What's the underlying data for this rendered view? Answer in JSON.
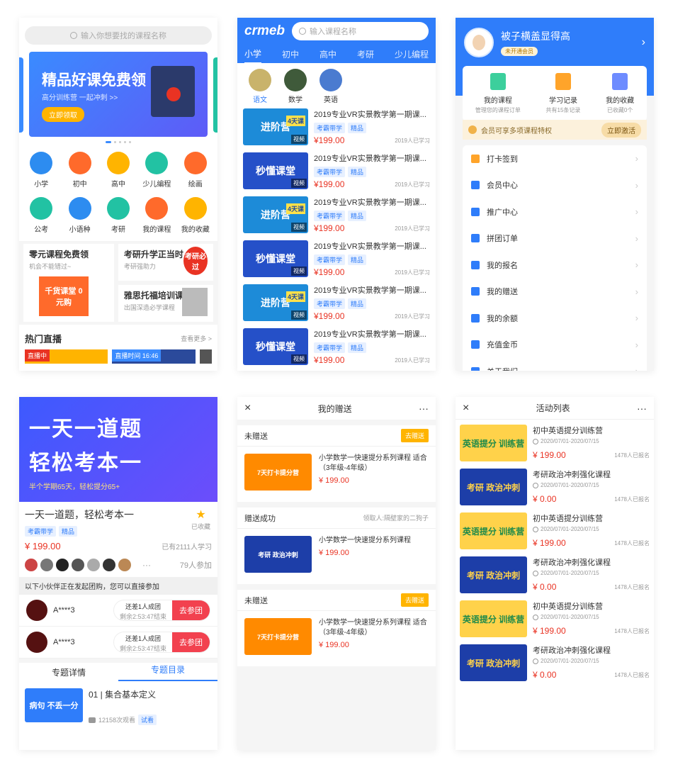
{
  "home": {
    "search_placeholder": "输入你想要找的课程名称",
    "banner_title": "精品好课免费领",
    "banner_sub": "高分训练营 一起冲刺 >>",
    "banner_btn": "立即领取",
    "cats": [
      {
        "label": "小学",
        "color": "#2d8cf0",
        "icon": "leaf-icon"
      },
      {
        "label": "初中",
        "color": "#ff6a2b",
        "icon": "book-icon"
      },
      {
        "label": "高中",
        "color": "#ffb400",
        "icon": "pencil-icon"
      },
      {
        "label": "少儿编程",
        "color": "#22c2a3",
        "icon": "code-icon"
      },
      {
        "label": "绘画",
        "color": "#ff6a2b",
        "icon": "palette-icon"
      },
      {
        "label": "公考",
        "color": "#22c2a3",
        "icon": "people-icon"
      },
      {
        "label": "小语种",
        "color": "#2d8cf0",
        "icon": "globe-icon"
      },
      {
        "label": "考研",
        "color": "#22c2a3",
        "icon": "cap-icon"
      },
      {
        "label": "我的课程",
        "color": "#ff6a2b",
        "icon": "open-book-icon"
      },
      {
        "label": "我的收藏",
        "color": "#ffb400",
        "icon": "star-icon"
      }
    ],
    "promo1_title": "零元课程免费领",
    "promo1_sub": "机会不能错过~",
    "promo1_img": "千货课堂 0元购",
    "promo2_title": "考研升学正当时",
    "promo2_sub": "考研强助力",
    "promo2_img": "考研必过",
    "promo3_title": "雅思托福培训课",
    "promo3_sub": "出国深造必学课程",
    "live_title": "热门直播",
    "live_more": "查看更多 >",
    "live_badge1": "直播中",
    "live_badge2": "直播时间 16:46"
  },
  "list": {
    "logo": "crmeb",
    "search_placeholder": "输入课程名称",
    "tabs": [
      "小学",
      "初中",
      "高中",
      "考研",
      "少儿编程"
    ],
    "subjects": [
      "语文",
      "数学",
      "英语"
    ],
    "items": [
      {
        "title": "2019专业VR实景教学第一期课...",
        "img": "进阶营",
        "badge": "4天课",
        "tags": [
          "考霸带学",
          "精品"
        ],
        "price": "¥199.00",
        "count": "2019人已学习",
        "type": "视频"
      },
      {
        "title": "2019专业VR实景教学第一期课...",
        "img": "秒懂课堂",
        "badge": "",
        "tags": [
          "考霸带学",
          "精品"
        ],
        "price": "¥199.00",
        "count": "2019人已学习",
        "type": "视频"
      },
      {
        "title": "2019专业VR实景教学第一期课...",
        "img": "进阶营",
        "badge": "4天课",
        "tags": [
          "考霸带学",
          "精品"
        ],
        "price": "¥199.00",
        "count": "2019人已学习",
        "type": "视频"
      },
      {
        "title": "2019专业VR实景教学第一期课...",
        "img": "秒懂课堂",
        "badge": "",
        "tags": [
          "考霸带学",
          "精品"
        ],
        "price": "¥199.00",
        "count": "2019人已学习",
        "type": "视频"
      },
      {
        "title": "2019专业VR实景教学第一期课...",
        "img": "进阶营",
        "badge": "4天课",
        "tags": [
          "考霸带学",
          "精品"
        ],
        "price": "¥199.00",
        "count": "2019人已学习",
        "type": "视频"
      },
      {
        "title": "2019专业VR实景教学第一期课...",
        "img": "秒懂课堂",
        "badge": "",
        "tags": [
          "考霸带学",
          "精品"
        ],
        "price": "¥199.00",
        "count": "2019人已学习",
        "type": "视频"
      }
    ]
  },
  "user": {
    "name": "被子横盖显得高",
    "member": "未开通会员",
    "stats": [
      {
        "label": "我的课程",
        "sub": "管理您的课程订单",
        "color": "#3ccf9c"
      },
      {
        "label": "学习记录",
        "sub": "共有15条记录",
        "color": "#ffa42a"
      },
      {
        "label": "我的收藏",
        "sub": "已收藏0个",
        "color": "#6e8cff"
      }
    ],
    "vip_text": "会员可享多项课程特权",
    "vip_btn": "立即激活",
    "menu": [
      "打卡签到",
      "会员中心",
      "推广中心",
      "拼团订单",
      "我的报名",
      "我的赠送",
      "我的余额",
      "充值金币",
      "关于我们"
    ]
  },
  "detail": {
    "hero_line1": "一天一道题",
    "hero_line2": "轻松考本一",
    "hero_line3": "半个学期65天，轻松提分65+",
    "title": "一天一道题，轻松考本一",
    "fav": "已收藏",
    "tags": [
      "考霸带学",
      "精品"
    ],
    "price": "¥ 199.00",
    "learners": "已有2111人学习",
    "participants": "79人参加",
    "dots": "···",
    "group_hint": "以下小伙伴正在发起团购，您可以直接参加",
    "groups": [
      {
        "name": "A****3",
        "need": "还差1人成团",
        "left": "剩余2:53:47结束",
        "btn": "去参团"
      },
      {
        "name": "A****3",
        "need": "还差1人成团",
        "left": "剩余2:53:47结束",
        "btn": "去参团"
      }
    ],
    "tabs": [
      "专题详情",
      "专题目录"
    ],
    "lesson_title": "01 | 集合基本定义",
    "lesson_views": "12158次观看",
    "lesson_tag": "试看",
    "lesson_img": "病句 不丢一分"
  },
  "gifts": {
    "title": "我的赠送",
    "close": "×",
    "more": "···",
    "sections": [
      {
        "status": "未赠送",
        "right": "去赠送",
        "right_type": "button",
        "course": "小学数学一快速提分系列课程 适合（3年级-4年级）",
        "price": "¥ 199.00",
        "img": "7天打卡提分营"
      },
      {
        "status": "赠送成功",
        "right": "领取人:隔壁家的二狗子",
        "right_type": "text",
        "course": "小学数学一快速提分系列课程",
        "price": "¥ 199.00",
        "img": "考研 政治冲刺"
      },
      {
        "status": "未赠送",
        "right": "去赠送",
        "right_type": "button",
        "course": "小学数学一快速提分系列课程 适合（3年级-4年级）",
        "price": "¥ 199.00",
        "img": "7天打卡提分营"
      }
    ]
  },
  "events": {
    "title": "活动列表",
    "close": "×",
    "more": "···",
    "items": [
      {
        "title": "初中英语提分训练营",
        "date": "2020/07/01-2020/07/15",
        "price": "¥ 199.00",
        "count": "1478人已报名",
        "img": "英语提分 训练营"
      },
      {
        "title": "考研政治冲刺强化课程",
        "date": "2020/07/01-2020/07/15",
        "price": "¥ 0.00",
        "count": "1478人已报名",
        "img": "考研 政治冲刺"
      },
      {
        "title": "初中英语提分训练营",
        "date": "2020/07/01-2020/07/15",
        "price": "¥ 199.00",
        "count": "1478人已报名",
        "img": "英语提分 训练营"
      },
      {
        "title": "考研政治冲刺强化课程",
        "date": "2020/07/01-2020/07/15",
        "price": "¥ 0.00",
        "count": "1478人已报名",
        "img": "考研 政治冲刺"
      },
      {
        "title": "初中英语提分训练营",
        "date": "2020/07/01-2020/07/15",
        "price": "¥ 199.00",
        "count": "1478人已报名",
        "img": "英语提分 训练营"
      },
      {
        "title": "考研政治冲刺强化课程",
        "date": "2020/07/01-2020/07/15",
        "price": "¥ 0.00",
        "count": "1478人已报名",
        "img": "考研 政治冲刺"
      }
    ]
  }
}
